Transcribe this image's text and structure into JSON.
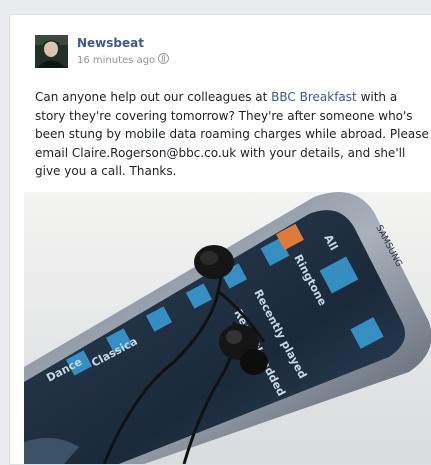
{
  "post": {
    "author": "Newsbeat",
    "timestamp": "16 minutes ago",
    "privacy_icon": "globe-icon",
    "text_before_link": "Can anyone help out our colleagues at ",
    "link_text": "BBC Breakfast",
    "text_after_link": " with a story they're covering tomorrow? They're after someone who's been stung by mobile data roaming charges while abroad. Please email Claire.Rogerson@bbc.co.uk with your details, and she'll give you a call. Thanks."
  },
  "photo": {
    "screen_labels": [
      "Dance",
      "Classica",
      "Recently played",
      "Recently added",
      "Ringtone",
      "All"
    ],
    "brand": "SAMSUNG"
  },
  "colors": {
    "link": "#3b5998",
    "page_background": "#e9ebee",
    "card_background": "#ffffff"
  }
}
